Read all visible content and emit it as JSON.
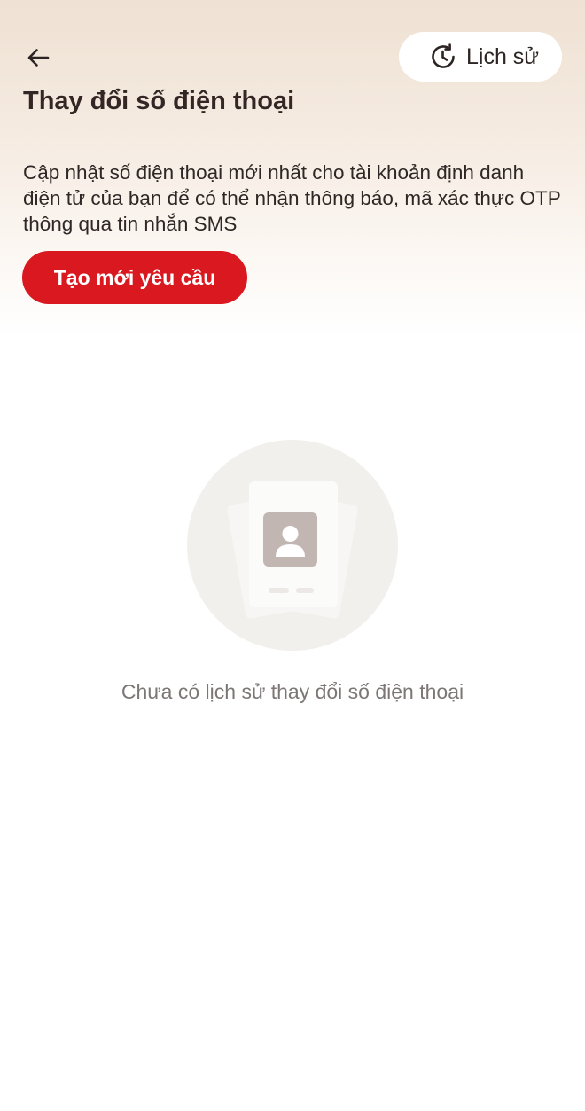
{
  "header": {
    "back_icon": "arrow-left-icon",
    "history_button": {
      "icon": "history-clock-icon",
      "label": "Lịch sử"
    },
    "title": "Thay đổi số điện thoại",
    "description": "Cập nhật số điện thoại mới nhất cho tài khoản định danh điện tử của bạn để có thể nhận thông báo, mã xác thực OTP thông qua tin nhắn SMS",
    "create_button_label": "Tạo mới yêu cầu"
  },
  "empty_state": {
    "icon": "id-card-illustration",
    "message": "Chưa có lịch sử thay đổi số điện thoại"
  },
  "colors": {
    "primary": "#d9181f",
    "header_gradient_top": "#efe1d3",
    "text_primary": "#332624",
    "text_muted": "#7c7775"
  }
}
